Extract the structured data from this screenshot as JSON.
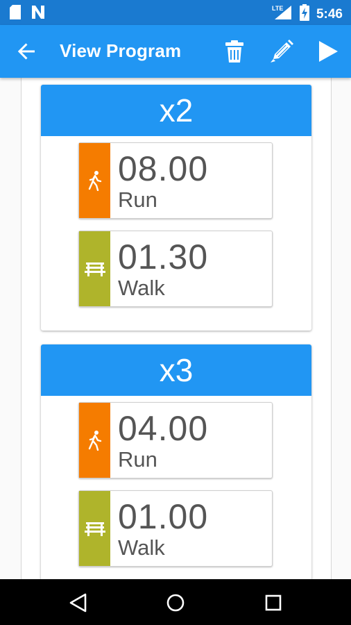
{
  "status_bar": {
    "time": "5:46",
    "network": "LTE",
    "left_icons": [
      "sd-card-icon",
      "notification-n-icon"
    ],
    "right_icons": [
      "signal-icon",
      "battery-charging-icon"
    ]
  },
  "app_bar": {
    "title": "View Program",
    "actions": [
      "trash-icon",
      "pencil-icon",
      "play-icon"
    ]
  },
  "colors": {
    "primary": "#2196f3",
    "status_bar": "#1a7ad0",
    "run": "#f57c00",
    "walk": "#afb42b"
  },
  "intervals": [
    {
      "repeat": "x2",
      "steps": [
        {
          "time": "08.00",
          "label": "Run",
          "icon": "running-person-icon"
        },
        {
          "time": "01.30",
          "label": "Walk",
          "icon": "bench-icon"
        }
      ]
    },
    {
      "repeat": "x3",
      "steps": [
        {
          "time": "04.00",
          "label": "Run",
          "icon": "running-person-icon"
        },
        {
          "time": "01.00",
          "label": "Walk",
          "icon": "bench-icon"
        }
      ]
    }
  ]
}
